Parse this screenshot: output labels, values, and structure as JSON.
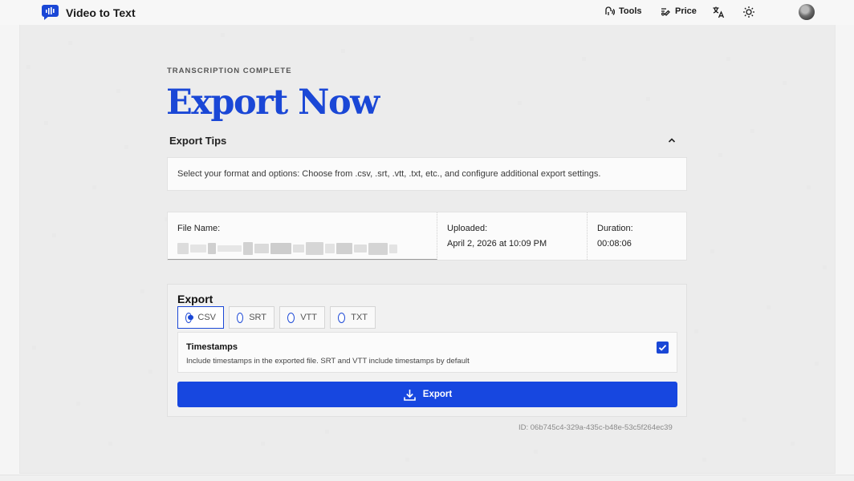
{
  "header": {
    "brand": "Video to Text",
    "nav": [
      {
        "label": "Tools",
        "icon": "tools-icon"
      },
      {
        "label": "Price",
        "icon": "price-icon"
      }
    ],
    "icons": [
      "translate-icon",
      "theme-sun-icon",
      "user-avatar"
    ]
  },
  "hero": {
    "eyebrow": "TRANSCRIPTION COMPLETE",
    "title": "Export Now"
  },
  "tips": {
    "heading": "Export Tips",
    "body": "Select your format and options: Choose from .csv, .srt, .vtt, .txt, etc., and configure additional export settings."
  },
  "file": {
    "name_label": "File Name:",
    "uploaded_label": "Uploaded:",
    "uploaded_value": "April 2, 2026 at 10:09 PM",
    "duration_label": "Duration:",
    "duration_value": "00:08:06"
  },
  "export": {
    "heading": "Export",
    "formats": [
      {
        "label": "CSV",
        "selected": true
      },
      {
        "label": "SRT",
        "selected": false
      },
      {
        "label": "VTT",
        "selected": false
      },
      {
        "label": "TXT",
        "selected": false
      }
    ],
    "timestamps": {
      "title": "Timestamps",
      "description": "Include timestamps in the exported file. SRT and VTT include timestamps by default",
      "checked": true
    },
    "button_label": "Export"
  },
  "record_id": "ID: 06b745c4-329a-435c-b48e-53c5f264ec39",
  "colors": {
    "accent": "#1a47d6",
    "button": "#1747e0"
  }
}
